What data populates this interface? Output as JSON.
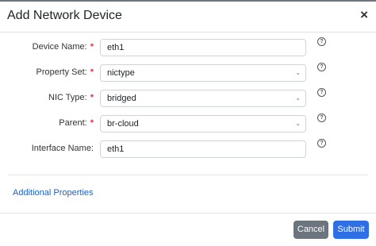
{
  "dialog": {
    "title": "Add Network Device",
    "close_icon": "×"
  },
  "form": {
    "fields": [
      {
        "label": "Device Name:",
        "required": true,
        "type": "input",
        "value": "eth1"
      },
      {
        "label": "Property Set:",
        "required": true,
        "type": "select",
        "value": "nictype"
      },
      {
        "label": "NIC Type:",
        "required": true,
        "type": "select",
        "value": "bridged"
      },
      {
        "label": "Parent:",
        "required": true,
        "type": "select",
        "value": "br-cloud"
      },
      {
        "label": "Interface Name:",
        "required": false,
        "type": "input",
        "value": "eth1"
      }
    ],
    "required_marker": "*",
    "help_icon": "?",
    "select_chevron": "⌄"
  },
  "additional_properties_label": "Additional Properties",
  "buttons": {
    "cancel": "Cancel",
    "submit": "Submit"
  },
  "colors": {
    "primary": "#2f6fe5",
    "secondary": "#6c757d",
    "required": "#dc3545",
    "link": "#1d63c6"
  }
}
